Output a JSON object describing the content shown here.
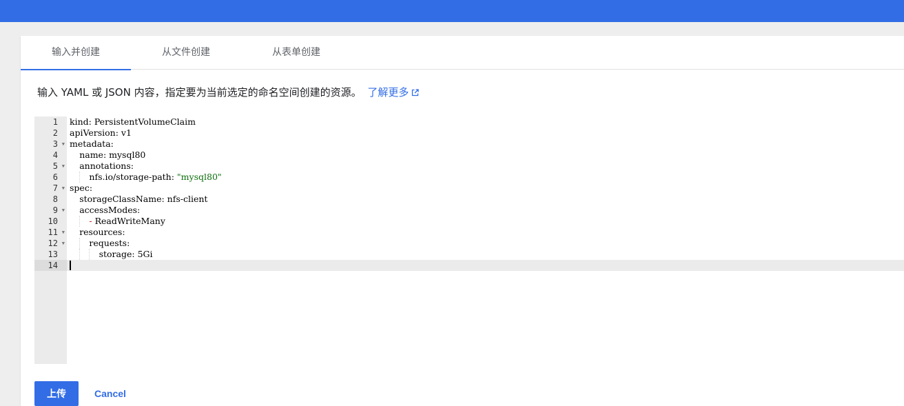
{
  "tabs": [
    {
      "label": "输入并创建",
      "active": true
    },
    {
      "label": "从文件创建",
      "active": false
    },
    {
      "label": "从表单创建",
      "active": false
    }
  ],
  "description": {
    "text": "输入 YAML 或 JSON 内容，指定要为当前选定的命名空间创建的资源。",
    "link_label": "了解更多"
  },
  "editor": {
    "lines": [
      {
        "num": "1",
        "indent": 0,
        "fold": false,
        "key": "kind:",
        "value": " PersistentVolumeClaim"
      },
      {
        "num": "2",
        "indent": 0,
        "fold": false,
        "key": "apiVersion:",
        "value": " v1"
      },
      {
        "num": "3",
        "indent": 0,
        "fold": true,
        "key": "metadata:",
        "value": ""
      },
      {
        "num": "4",
        "indent": 1,
        "fold": false,
        "key": "name:",
        "value": " mysql80"
      },
      {
        "num": "5",
        "indent": 1,
        "fold": true,
        "key": "annotations:",
        "value": ""
      },
      {
        "num": "6",
        "indent": 2,
        "fold": false,
        "key": "nfs.io/storage-path:",
        "value": " \"mysql80\"",
        "string": true
      },
      {
        "num": "7",
        "indent": 0,
        "fold": true,
        "key": "spec:",
        "value": ""
      },
      {
        "num": "8",
        "indent": 1,
        "fold": false,
        "key": "storageClassName:",
        "value": " nfs-client"
      },
      {
        "num": "9",
        "indent": 1,
        "fold": true,
        "key": "accessModes:",
        "value": ""
      },
      {
        "num": "10",
        "indent": 2,
        "fold": false,
        "key": "- ",
        "value": "ReadWriteMany"
      },
      {
        "num": "11",
        "indent": 1,
        "fold": true,
        "key": "resources:",
        "value": ""
      },
      {
        "num": "12",
        "indent": 2,
        "fold": true,
        "key": "requests:",
        "value": ""
      },
      {
        "num": "13",
        "indent": 3,
        "fold": false,
        "key": "storage:",
        "value": " 5Gi"
      },
      {
        "num": "14",
        "indent": 0,
        "fold": false,
        "key": "",
        "value": "",
        "active": true
      }
    ]
  },
  "actions": {
    "upload_label": "上传",
    "cancel_label": "Cancel"
  },
  "colors": {
    "accent": "#326de6",
    "string": "#0b6e0b"
  }
}
